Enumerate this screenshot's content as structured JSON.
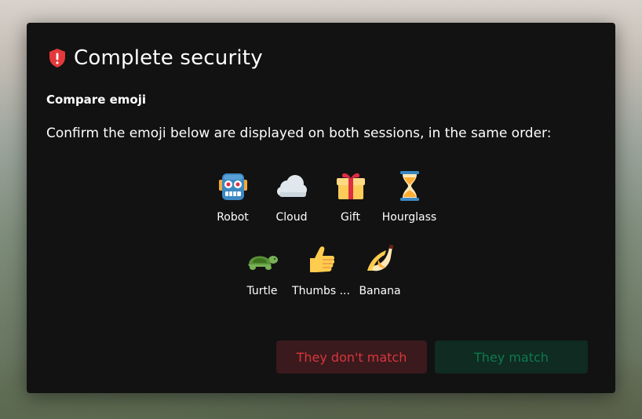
{
  "dialog": {
    "title": "Complete security",
    "subtitle": "Compare emoji",
    "description": "Confirm the emoji below are displayed on both sessions, in the same order:",
    "emoji_rows": [
      [
        {
          "icon": "robot-icon",
          "label": "Robot"
        },
        {
          "icon": "cloud-icon",
          "label": "Cloud"
        },
        {
          "icon": "gift-icon",
          "label": "Gift"
        },
        {
          "icon": "hourglass-icon",
          "label": "Hourglass"
        }
      ],
      [
        {
          "icon": "turtle-icon",
          "label": "Turtle"
        },
        {
          "icon": "thumbs-up-icon",
          "label": "Thumbs ..."
        },
        {
          "icon": "banana-icon",
          "label": "Banana"
        }
      ]
    ],
    "buttons": {
      "no_match": "They don't match",
      "match": "They match"
    }
  },
  "colors": {
    "dialog_bg": "#121212",
    "danger": "#d9363e",
    "danger_bg": "#3a1a1c",
    "success": "#0e7a4d",
    "success_bg": "#0f2b22",
    "shield": "#e5383b"
  }
}
